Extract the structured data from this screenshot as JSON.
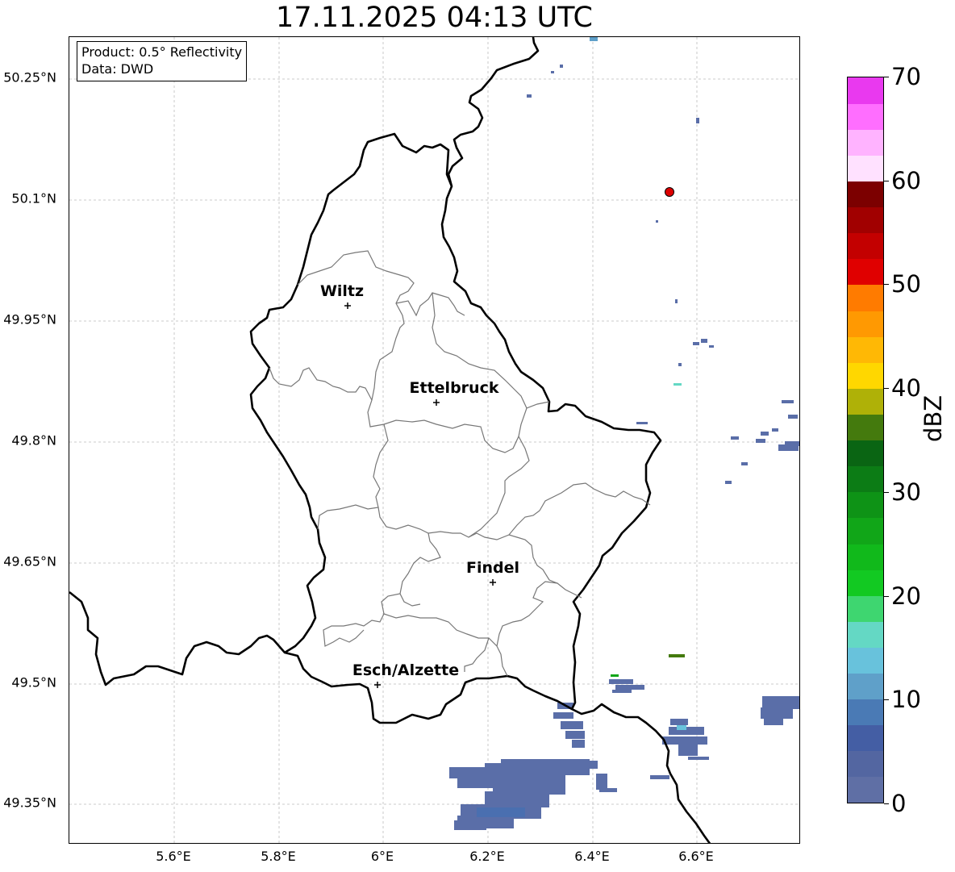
{
  "title": "17.11.2025 04:13 UTC",
  "info_box": {
    "product": "Product: 0.5° Reflectivity",
    "data": "Data: DWD"
  },
  "lat_labels": [
    "50.25°N",
    "50.1°N",
    "49.95°N",
    "49.8°N",
    "49.65°N",
    "49.5°N",
    "49.35°N"
  ],
  "lon_labels": [
    "5.6°E",
    "5.8°E",
    "6°E",
    "6.2°E",
    "6.4°E",
    "6.6°E"
  ],
  "cities": [
    {
      "name": "Wiltz"
    },
    {
      "name": "Ettelbruck"
    },
    {
      "name": "Findel"
    },
    {
      "name": "Esch/Alzette"
    }
  ],
  "colorbar": {
    "label": "dBZ",
    "ticks": [
      "0",
      "10",
      "20",
      "30",
      "40",
      "50",
      "60",
      "70"
    ],
    "colors": [
      "#5f6fa5",
      "#5366a1",
      "#445ea4",
      "#4a7ab5",
      "#5fa0c9",
      "#68c2dc",
      "#64d8c4",
      "#3ed670",
      "#12c922",
      "#11b91b",
      "#11a618",
      "#0e9316",
      "#0c7c15",
      "#0a6513",
      "#447a0d",
      "#afb107",
      "#ffd700",
      "#ffb805",
      "#ff9902",
      "#ff7b00",
      "#e00000",
      "#c30000",
      "#a10000",
      "#7c0000",
      "#ffe1ff",
      "#ffb3ff",
      "#ff6eff",
      "#e939ef"
    ]
  },
  "colors": {
    "border": "#000000",
    "canton_line": "#777777",
    "grid": "#bbbbbb",
    "radar_site": "#dd0000"
  }
}
